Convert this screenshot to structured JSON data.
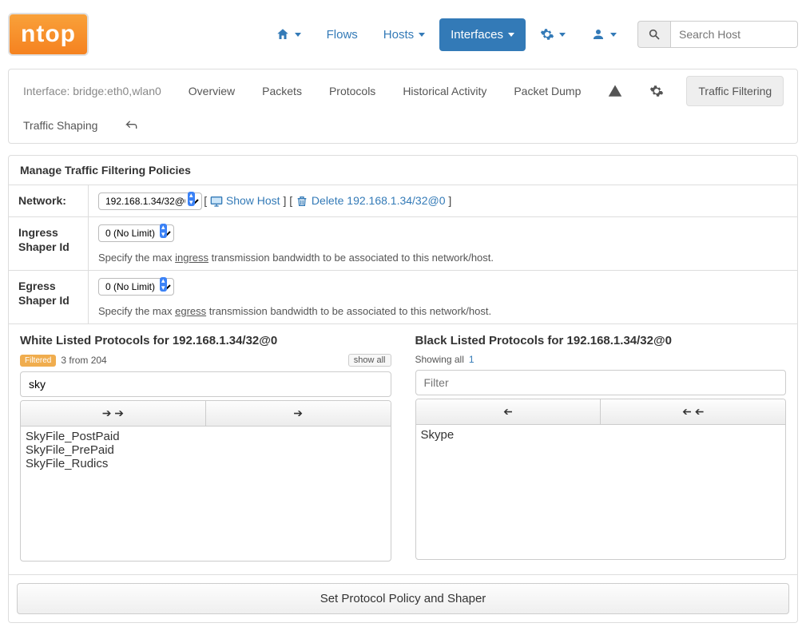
{
  "brand": "ntop",
  "topnav": {
    "home_icon": "home",
    "flows": "Flows",
    "hosts": "Hosts",
    "interfaces": "Interfaces",
    "gear_icon": "gear",
    "user_icon": "user"
  },
  "search": {
    "placeholder": "Search Host"
  },
  "tabs": {
    "iface_label": "Interface: bridge:eth0,wlan0",
    "overview": "Overview",
    "packets": "Packets",
    "protocols": "Protocols",
    "historical": "Historical Activity",
    "packet_dump": "Packet Dump",
    "traffic_filtering": "Traffic Filtering",
    "traffic_shaping": "Traffic Shaping"
  },
  "heading": "Manage Traffic Filtering Policies",
  "rows": {
    "network": {
      "label": "Network:",
      "selected": "192.168.1.34/32@0",
      "show_host": "Show Host",
      "delete_prefix": "Delete ",
      "delete_target": "192.168.1.34/32@0"
    },
    "ingress": {
      "label": "Ingress Shaper Id",
      "selected": "0 (No Limit)",
      "help_pre": "Specify the max ",
      "help_u": "ingress",
      "help_post": " transmission bandwidth to be associated to this network/host."
    },
    "egress": {
      "label": "Egress Shaper Id",
      "selected": "0 (No Limit)",
      "help_pre": "Specify the max ",
      "help_u": "egress",
      "help_post": " transmission bandwidth to be associated to this network/host."
    }
  },
  "whitelist": {
    "title": "White Listed Protocols for 192.168.1.34/32@0",
    "badge": "Filtered",
    "meta": "3 from 204",
    "showall": "show all",
    "filter_value": "sky",
    "items": [
      "SkyFile_PostPaid",
      "SkyFile_PrePaid",
      "SkyFile_Rudics"
    ]
  },
  "blacklist": {
    "title": "Black Listed Protocols for 192.168.1.34/32@0",
    "meta_pre": "Showing all ",
    "meta_count": "1",
    "filter_placeholder": "Filter",
    "items": [
      "Skype"
    ]
  },
  "footer": {
    "button": "Set Protocol Policy and Shaper"
  }
}
